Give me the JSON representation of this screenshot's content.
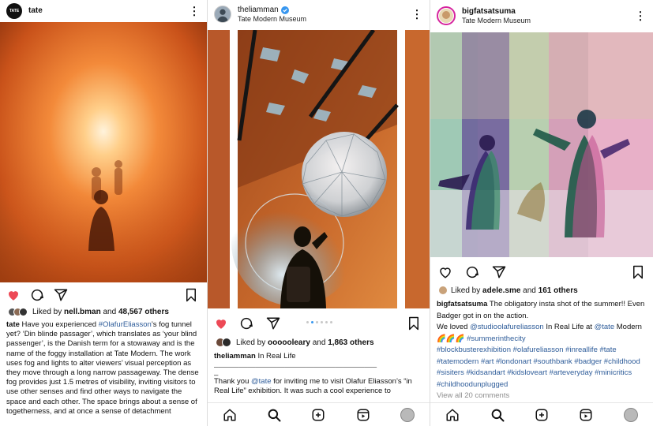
{
  "posts": [
    {
      "username": "tate",
      "location": "",
      "avatar_text": "TATE",
      "liked_by_user": "nell.bman",
      "liked_by_count": "48,567 others",
      "caption_user": "tate",
      "caption_pre": "Have you experienced ",
      "caption_tag": "#OlafurEliasson",
      "caption_post": "’s fog tunnel yet? ‘Din blinde passager’, which translates as ‘your blind passenger’, is the Danish term for a stowaway and is the name of the foggy installation at Tate Modern. The work uses fog and lights to alter viewers’ visual perception as they move through a long narrow passageway. The dense fog provides just 1.5 metres of visibility, inviting visitors to use other senses and find other ways to navigate the space and each other. The space brings about a sense of togetherness, and at once a sense of detachment",
      "icons": [
        "heart-filled-icon",
        "comment-icon",
        "share-icon",
        "bookmark-icon"
      ]
    },
    {
      "username": "theliamman",
      "location": "Tate Modern Museum",
      "verified": true,
      "liked_by_user": "oooooleary",
      "liked_by_count": "1,863 others",
      "caption_user": "theliamman",
      "caption_text": "In Real Life",
      "caption_rule": "_______________________________________",
      "caption_dash": "_",
      "body_pre": "Thank you ",
      "body_mention": "@tate",
      "body_post": " for inviting me to visit Olafur Eliasson’s “in Real Life” exhibition. It was such a cool experience to",
      "carousel_dots": 6,
      "carousel_active": 1
    },
    {
      "username": "bigfatsatsuma",
      "location": "Tate Modern Museum",
      "liked_by_user": "adele.sme",
      "liked_by_count": "161 others",
      "caption_user": "bigfatsatsuma",
      "caption_line1": "The obligatory insta shot of the summer!! Even Badger got in on the action.",
      "caption_we": "We loved ",
      "caption_mention1": "@studioolafureliasson",
      "caption_mid": " In Real Life at ",
      "caption_mention2": "@tate",
      "caption_modern": " Modern ",
      "caption_emoji": "🌈🌈🌈",
      "caption_tag1": "#summerinthecity",
      "caption_tags": "#blockbusterexhibition #olafureliasson #inreallife #tate #tatemodern #art #londonart #southbank #badger #childhood #sisiters #kidsandart #kidsloveart #arteveryday #minicritics #childhoodunplugged",
      "view_comments": "View all 20 comments"
    }
  ],
  "colors": {
    "like_red": "#ed4956",
    "link_blue": "#2f5d9a",
    "verified_blue": "#3897f0"
  },
  "nav_icons": [
    "home-icon",
    "search-icon",
    "add-post-icon",
    "reels-icon",
    "profile-avatar"
  ]
}
